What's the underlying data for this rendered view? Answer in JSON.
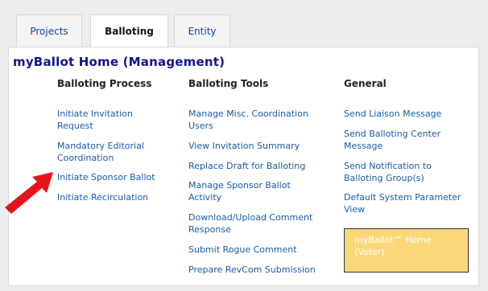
{
  "tabs": [
    "Projects",
    "Balloting",
    "Entity"
  ],
  "page_title": "myBallot Home (Management)",
  "columns": [
    {
      "heading": "Balloting Process",
      "links": [
        "Initiate Invitation Request",
        "Mandatory Editorial Coordination",
        "Initiate Sponsor Ballot",
        "Initiate Recirculation"
      ]
    },
    {
      "heading": "Balloting Tools",
      "links": [
        "Manage Misc. Coordination Users",
        "View Invitation Summary",
        "Replace Draft for Balloting",
        "Manage Sponsor Ballot Activity",
        "Download/Upload Comment Response",
        "Submit Rogue Comment",
        "Prepare RevCom Submission"
      ]
    },
    {
      "heading": "General",
      "links": [
        "Send Liaison Message",
        "Send Balloting Center Message",
        "Send Notification to Balloting Group(s)",
        "Default System Parameter View"
      ]
    }
  ],
  "voter_home_link": "myBallot™ Home (Voter)",
  "colors": {
    "accent_title": "#14148c",
    "link": "#1a5aa8",
    "note_bg": "#fbd77a",
    "arrow": "#e8141b"
  },
  "icons": [
    "arrow-pointer-icon"
  ]
}
